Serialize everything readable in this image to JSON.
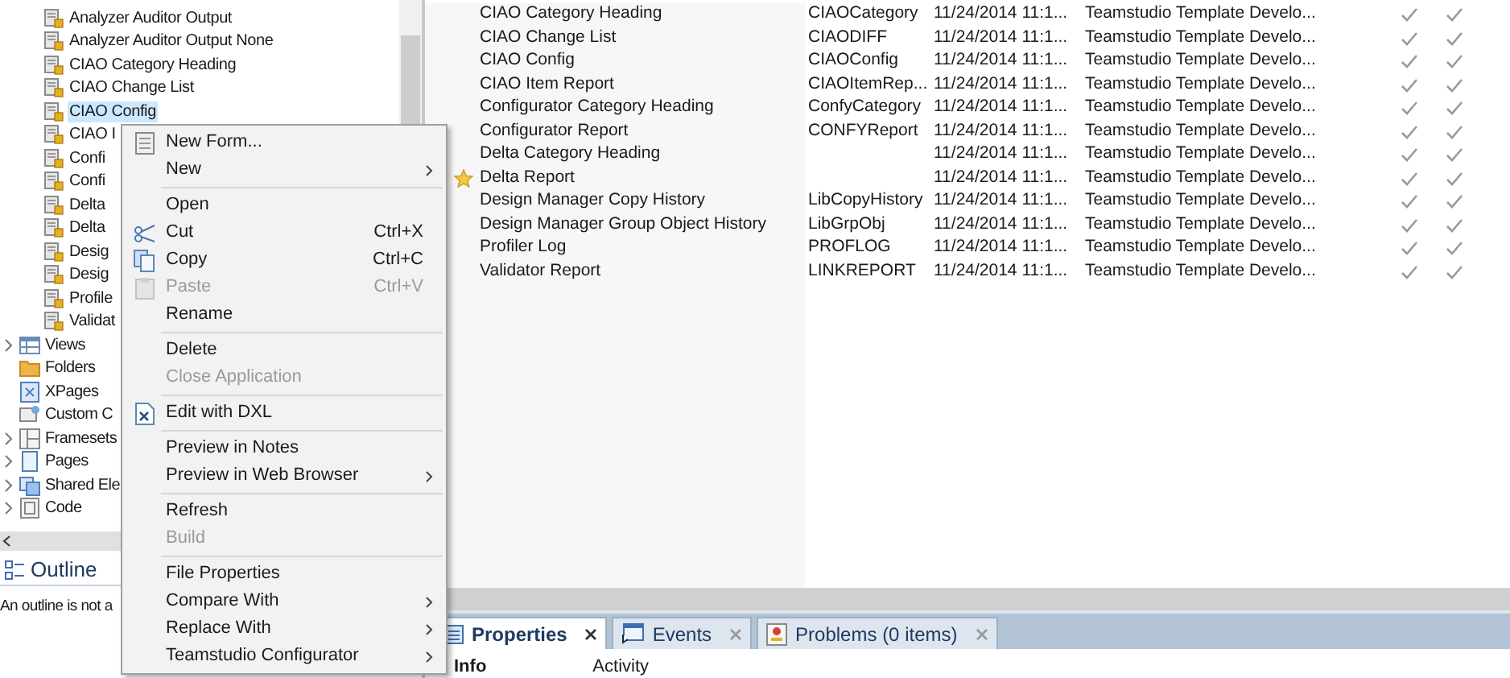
{
  "tree": {
    "forms": [
      {
        "label": "Analyzer Auditor Output",
        "selected": false
      },
      {
        "label": "Analyzer Auditor Output None",
        "selected": false
      },
      {
        "label": "CIAO Category Heading",
        "selected": false
      },
      {
        "label": "CIAO Change List",
        "selected": false
      },
      {
        "label": "CIAO Config",
        "selected": true
      },
      {
        "label": "CIAO I",
        "selected": false
      },
      {
        "label": "Confi",
        "selected": false
      },
      {
        "label": "Confi",
        "selected": false
      },
      {
        "label": "Delta",
        "selected": false
      },
      {
        "label": "Delta",
        "selected": false
      },
      {
        "label": "Desig",
        "selected": false
      },
      {
        "label": "Desig",
        "selected": false
      },
      {
        "label": "Profile",
        "selected": false
      },
      {
        "label": "Validat",
        "selected": false
      }
    ],
    "design": [
      {
        "label": "Views",
        "kind": "views",
        "expandable": true
      },
      {
        "label": "Folders",
        "kind": "folders",
        "expandable": false
      },
      {
        "label": "XPages",
        "kind": "xpages",
        "expandable": false
      },
      {
        "label": "Custom C",
        "kind": "custom",
        "expandable": false
      },
      {
        "label": "Framesets",
        "kind": "framesets",
        "expandable": true
      },
      {
        "label": "Pages",
        "kind": "pages",
        "expandable": true
      },
      {
        "label": "Shared Ele",
        "kind": "shared",
        "expandable": true
      },
      {
        "label": "Code",
        "kind": "code",
        "expandable": true
      }
    ]
  },
  "outline": {
    "title": "Outline",
    "message": "An outline is not a"
  },
  "table": {
    "rows": [
      {
        "name": "CIAO Category Heading",
        "alias": "CIAOCategory",
        "modified": "11/24/2014 11:1...",
        "modified_by": "Teamstudio Template Develo...",
        "starred": false
      },
      {
        "name": "CIAO Change List",
        "alias": "CIAODIFF",
        "modified": "11/24/2014 11:1...",
        "modified_by": "Teamstudio Template Develo...",
        "starred": false
      },
      {
        "name": "CIAO Config",
        "alias": "CIAOConfig",
        "modified": "11/24/2014 11:1...",
        "modified_by": "Teamstudio Template Develo...",
        "starred": false
      },
      {
        "name": "CIAO Item Report",
        "alias": "CIAOItemRep...",
        "modified": "11/24/2014 11:1...",
        "modified_by": "Teamstudio Template Develo...",
        "starred": false
      },
      {
        "name": "Configurator Category Heading",
        "alias": "ConfyCategory",
        "modified": "11/24/2014 11:1...",
        "modified_by": "Teamstudio Template Develo...",
        "starred": false
      },
      {
        "name": "Configurator Report",
        "alias": "CONFYReport",
        "modified": "11/24/2014 11:1...",
        "modified_by": "Teamstudio Template Develo...",
        "starred": false
      },
      {
        "name": "Delta Category Heading",
        "modified": "11/24/2014 11:1...",
        "modified_by": "Teamstudio Template Develo...",
        "starred": false
      },
      {
        "name": "Delta Report",
        "modified": "11/24/2014 11:1...",
        "modified_by": "Teamstudio Template Develo...",
        "starred": true
      },
      {
        "name": "Design Manager Copy History",
        "alias": "LibCopyHistory",
        "modified": "11/24/2014 11:1...",
        "modified_by": "Teamstudio Template Develo...",
        "starred": false
      },
      {
        "name": "Design Manager Group Object History",
        "alias": "LibGrpObj",
        "modified": "11/24/2014 11:1...",
        "modified_by": "Teamstudio Template Develo...",
        "starred": false
      },
      {
        "name": "Profiler Log",
        "alias": "PROFLOG",
        "modified": "11/24/2014 11:1...",
        "modified_by": "Teamstudio Template Develo...",
        "starred": false
      },
      {
        "name": "Validator Report",
        "alias": "LINKREPORT",
        "modified": "11/24/2014 11:1...",
        "modified_by": "Teamstudio Template Develo...",
        "starred": false
      }
    ]
  },
  "bottom_tabs": [
    {
      "label": "Properties",
      "kind": "properties",
      "selected": true
    },
    {
      "label": "Events",
      "kind": "events",
      "selected": false
    },
    {
      "label": "Problems (0 items)",
      "kind": "problems",
      "selected": false
    }
  ],
  "properties": {
    "side_tab": "Info",
    "section": "Activity"
  },
  "context_menu": [
    {
      "kind": "item",
      "label": "New Form...",
      "disabled": false,
      "submenu": false
    },
    {
      "kind": "item",
      "label": "New",
      "disabled": false,
      "submenu": true
    },
    {
      "kind": "separator"
    },
    {
      "kind": "item",
      "label": "Open",
      "disabled": false,
      "submenu": false
    },
    {
      "kind": "item",
      "label": "Cut",
      "shortcut": "Ctrl+X",
      "disabled": false,
      "submenu": false
    },
    {
      "kind": "item",
      "label": "Copy",
      "shortcut": "Ctrl+C",
      "disabled": false,
      "submenu": false
    },
    {
      "kind": "item",
      "label": "Paste",
      "shortcut": "Ctrl+V",
      "disabled": true,
      "submenu": false
    },
    {
      "kind": "item",
      "label": "Rename",
      "disabled": false,
      "submenu": false
    },
    {
      "kind": "separator"
    },
    {
      "kind": "item",
      "label": "Delete",
      "disabled": false,
      "submenu": false
    },
    {
      "kind": "item",
      "label": "Close Application",
      "disabled": true,
      "submenu": false
    },
    {
      "kind": "separator"
    },
    {
      "kind": "item",
      "label": "Edit with DXL",
      "disabled": false,
      "submenu": false
    },
    {
      "kind": "separator"
    },
    {
      "kind": "item",
      "label": "Preview in Notes",
      "disabled": false,
      "submenu": false
    },
    {
      "kind": "item",
      "label": "Preview in Web Browser",
      "disabled": false,
      "submenu": true
    },
    {
      "kind": "separator"
    },
    {
      "kind": "item",
      "label": "Refresh",
      "disabled": false,
      "submenu": false
    },
    {
      "kind": "item",
      "label": "Build",
      "disabled": true,
      "submenu": false
    },
    {
      "kind": "separator"
    },
    {
      "kind": "item",
      "label": "File Properties",
      "disabled": false,
      "submenu": false
    },
    {
      "kind": "item",
      "label": "Compare With",
      "disabled": false,
      "submenu": true
    },
    {
      "kind": "item",
      "label": "Replace With",
      "disabled": false,
      "submenu": true
    },
    {
      "kind": "item",
      "label": "Teamstudio Configurator",
      "disabled": false,
      "submenu": true
    }
  ]
}
